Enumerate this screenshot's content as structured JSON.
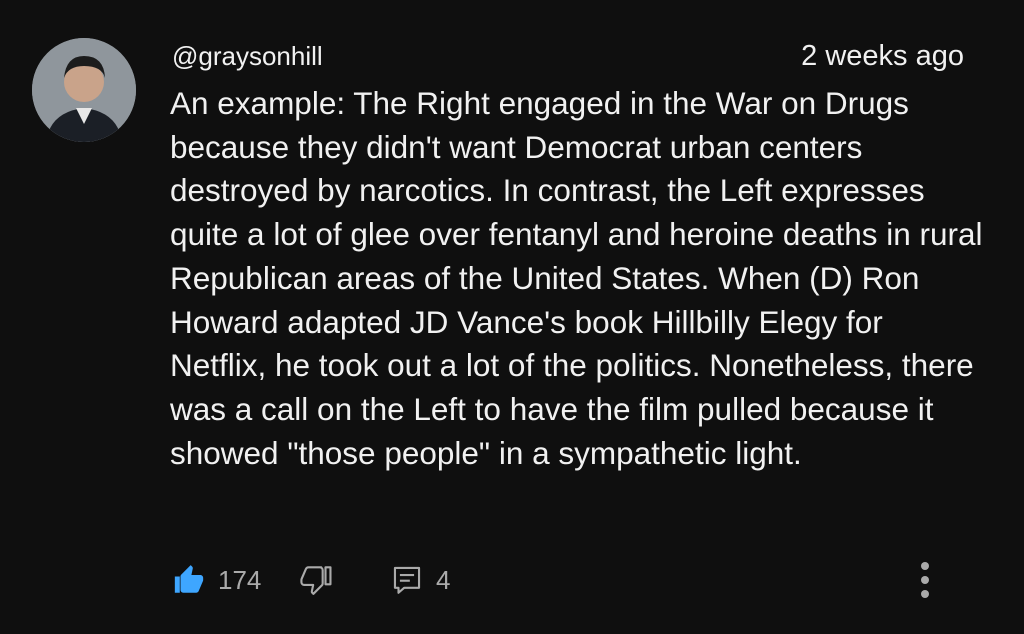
{
  "comment": {
    "author": "@graysonhill",
    "timestamp": "2 weeks ago",
    "text": "An example: The Right engaged in the War on Drugs because they didn't want Democrat urban centers destroyed by narcotics. In contrast, the Left expresses quite a lot of glee over fentanyl and heroine deaths in rural Republican areas of the United States. When (D) Ron Howard adapted JD Vance's book Hillbilly Elegy for Netflix, he took out a lot of the politics. Nonetheless, there was a call on the Left to have the film pulled because it showed \"those people\" in a sympathetic light."
  },
  "actions": {
    "like_count": "174",
    "like_icon": "thumbs-up-icon",
    "dislike_icon": "thumbs-down-icon",
    "reply_icon": "comment-icon",
    "reply_count": "4",
    "more_icon": "vertical-ellipsis-icon"
  },
  "colors": {
    "background": "#0f0f0f",
    "text": "#f1f1f1",
    "secondary_text": "#aaaaaa",
    "like_active": "#3ea6ff"
  }
}
